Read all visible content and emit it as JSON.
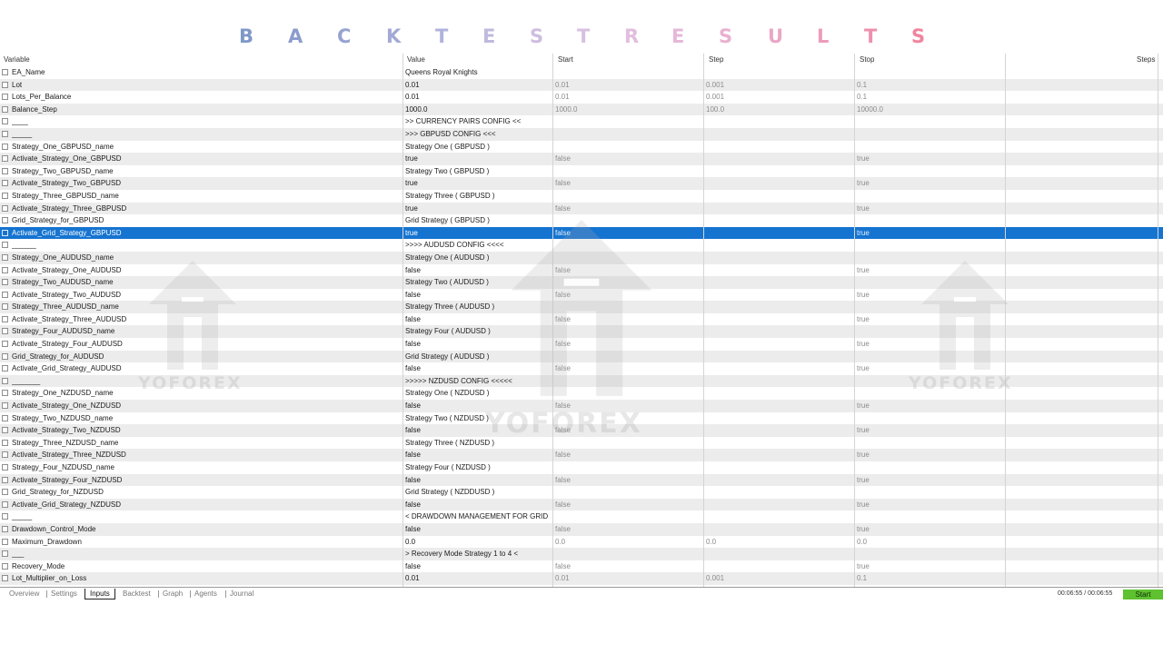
{
  "title": {
    "letters": [
      "B",
      "A",
      "C",
      "K",
      "T",
      "E",
      "S",
      "T",
      "R",
      "E",
      "S",
      "U",
      "L",
      "T",
      "S"
    ],
    "colors": [
      "#7f98c8",
      "#8b9ccd",
      "#96a3d1",
      "#a2a9d5",
      "#b0b3da",
      "#c0b9de",
      "#cdbde0",
      "#d8c0e0",
      "#e1bede",
      "#e6b8d8",
      "#e9b0d0",
      "#eaa6c6",
      "#ec9cbb",
      "#ee90ad",
      "#f0849e"
    ]
  },
  "columns": {
    "variable": "Variable",
    "value": "Value",
    "start": "Start",
    "step": "Step",
    "stop": "Stop",
    "steps": "Steps"
  },
  "rows": [
    {
      "var": "EA_Name",
      "val": "Queens Royal Knights",
      "start": "",
      "step": "",
      "stop": ""
    },
    {
      "var": "Lot",
      "val": "0.01",
      "start": "0.01",
      "step": "0.001",
      "stop": "0.1"
    },
    {
      "var": "Lots_Per_Balance",
      "val": "0.01",
      "start": "0.01",
      "step": "0.001",
      "stop": "0.1"
    },
    {
      "var": "Balance_Step",
      "val": "1000.0",
      "start": "1000.0",
      "step": "100.0",
      "stop": "10000.0"
    },
    {
      "var": "____",
      "val": ">> CURRENCY PAIRS CONFIG <<",
      "start": "",
      "step": "",
      "stop": ""
    },
    {
      "var": "_____",
      "val": ">>> GBPUSD CONFIG <<<",
      "start": "",
      "step": "",
      "stop": ""
    },
    {
      "var": "Strategy_One_GBPUSD_name",
      "val": "Strategy One ( GBPUSD )",
      "start": "",
      "step": "",
      "stop": ""
    },
    {
      "var": "Activate_Strategy_One_GBPUSD",
      "val": "true",
      "start": "false",
      "step": "",
      "stop": "true"
    },
    {
      "var": "Strategy_Two_GBPUSD_name",
      "val": "Strategy Two ( GBPUSD )",
      "start": "",
      "step": "",
      "stop": ""
    },
    {
      "var": "Activate_Strategy_Two_GBPUSD",
      "val": "true",
      "start": "false",
      "step": "",
      "stop": "true"
    },
    {
      "var": "Strategy_Three_GBPUSD_name",
      "val": "Strategy Three ( GBPUSD )",
      "start": "",
      "step": "",
      "stop": ""
    },
    {
      "var": "Activate_Strategy_Three_GBPUSD",
      "val": "true",
      "start": "false",
      "step": "",
      "stop": "true"
    },
    {
      "var": "Grid_Strategy_for_GBPUSD",
      "val": "Grid Strategy ( GBPUSD )",
      "start": "",
      "step": "",
      "stop": ""
    },
    {
      "var": "Activate_Grid_Strategy_GBPUSD",
      "val": "true",
      "start": "false",
      "step": "",
      "stop": "true",
      "selected": true
    },
    {
      "var": "______",
      "val": ">>>> AUDUSD CONFIG <<<<",
      "start": "",
      "step": "",
      "stop": ""
    },
    {
      "var": "Strategy_One_AUDUSD_name",
      "val": "Strategy One ( AUDUSD )",
      "start": "",
      "step": "",
      "stop": ""
    },
    {
      "var": "Activate_Strategy_One_AUDUSD",
      "val": "false",
      "start": "false",
      "step": "",
      "stop": "true"
    },
    {
      "var": "Strategy_Two_AUDUSD_name",
      "val": "Strategy Two ( AUDUSD )",
      "start": "",
      "step": "",
      "stop": ""
    },
    {
      "var": "Activate_Strategy_Two_AUDUSD",
      "val": "false",
      "start": "false",
      "step": "",
      "stop": "true"
    },
    {
      "var": "Strategy_Three_AUDUSD_name",
      "val": "Strategy Three ( AUDUSD )",
      "start": "",
      "step": "",
      "stop": ""
    },
    {
      "var": "Activate_Strategy_Three_AUDUSD",
      "val": "false",
      "start": "false",
      "step": "",
      "stop": "true"
    },
    {
      "var": "Strategy_Four_AUDUSD_name",
      "val": "Strategy Four ( AUDUSD )",
      "start": "",
      "step": "",
      "stop": ""
    },
    {
      "var": "Activate_Strategy_Four_AUDUSD",
      "val": "false",
      "start": "false",
      "step": "",
      "stop": "true"
    },
    {
      "var": "Grid_Strategy_for_AUDUSD",
      "val": "Grid Strategy ( AUDUSD )",
      "start": "",
      "step": "",
      "stop": ""
    },
    {
      "var": "Activate_Grid_Strategy_AUDUSD",
      "val": "false",
      "start": "false",
      "step": "",
      "stop": "true"
    },
    {
      "var": "_______",
      "val": ">>>>> NZDUSD CONFIG <<<<<",
      "start": "",
      "step": "",
      "stop": ""
    },
    {
      "var": "Strategy_One_NZDUSD_name",
      "val": "Strategy One ( NZDUSD )",
      "start": "",
      "step": "",
      "stop": ""
    },
    {
      "var": "Activate_Strategy_One_NZDUSD",
      "val": "false",
      "start": "false",
      "step": "",
      "stop": "true"
    },
    {
      "var": "Strategy_Two_NZDUSD_name",
      "val": "Strategy Two ( NZDUSD )",
      "start": "",
      "step": "",
      "stop": ""
    },
    {
      "var": "Activate_Strategy_Two_NZDUSD",
      "val": "false",
      "start": "false",
      "step": "",
      "stop": "true"
    },
    {
      "var": "Strategy_Three_NZDUSD_name",
      "val": "Strategy Three ( NZDUSD )",
      "start": "",
      "step": "",
      "stop": ""
    },
    {
      "var": "Activate_Strategy_Three_NZDUSD",
      "val": "false",
      "start": "false",
      "step": "",
      "stop": "true"
    },
    {
      "var": "Strategy_Four_NZDUSD_name",
      "val": "Strategy Four ( NZDUSD )",
      "start": "",
      "step": "",
      "stop": ""
    },
    {
      "var": "Activate_Strategy_Four_NZDUSD",
      "val": "false",
      "start": "false",
      "step": "",
      "stop": "true"
    },
    {
      "var": "Grid_Strategy_for_NZDUSD",
      "val": "Grid Strategy ( NZDDUSD )",
      "start": "",
      "step": "",
      "stop": ""
    },
    {
      "var": "Activate_Grid_Strategy_NZDUSD",
      "val": "false",
      "start": "false",
      "step": "",
      "stop": "true"
    },
    {
      "var": "_____",
      "val": "< DRAWDOWN MANAGEMENT FOR GRID STRATEGY ONLY >",
      "start": "",
      "step": "",
      "stop": ""
    },
    {
      "var": "Drawdown_Control_Mode",
      "val": "false",
      "start": "false",
      "step": "",
      "stop": "true"
    },
    {
      "var": "Maximum_Drawdown",
      "val": "0.0",
      "start": "0.0",
      "step": "0.0",
      "stop": "0.0"
    },
    {
      "var": "___",
      "val": "> Recovery Mode Strategy 1 to 4 <",
      "start": "",
      "step": "",
      "stop": ""
    },
    {
      "var": "Recovery_Mode",
      "val": "false",
      "start": "false",
      "step": "",
      "stop": "true"
    },
    {
      "var": "Lot_Multiplier_on_Loss",
      "val": "0.01",
      "start": "0.01",
      "step": "0.001",
      "stop": "0.1"
    }
  ],
  "tabs": [
    "Overview",
    "Settings",
    "Inputs",
    "Backtest",
    "Graph",
    "Agents",
    "Journal"
  ],
  "active_tab": "Inputs",
  "status": {
    "timer": "00:06:55 / 00:06:55",
    "start_button": "Start"
  },
  "watermark": {
    "text": "YOFOREX",
    "icon": "double-arrow-logo-icon"
  }
}
